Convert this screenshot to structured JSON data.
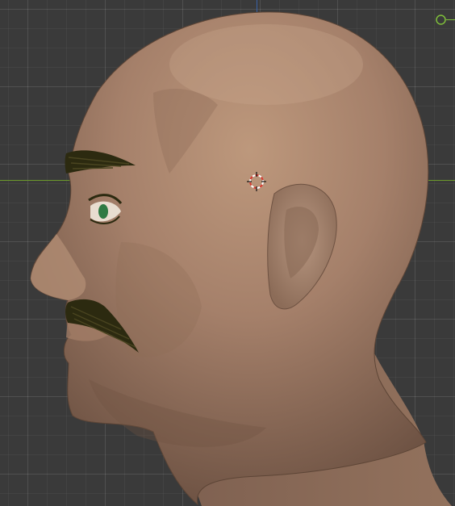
{
  "viewport": {
    "background": "#3a3a3a",
    "grid_color": "#4a4a4a",
    "x_axis_color": "#6c9a2c",
    "z_axis_color": "#3a63a8"
  },
  "model": {
    "skin_color": "#a88468",
    "hair_color": "#2c2a10",
    "eye_color": "#2e7a43"
  },
  "cursor": {
    "icon": "3d-cursor-icon",
    "ring_colors": [
      "#d9392f",
      "#ffffff"
    ]
  },
  "light": {
    "icon": "light-object-icon",
    "color": "#7fbf3a"
  }
}
